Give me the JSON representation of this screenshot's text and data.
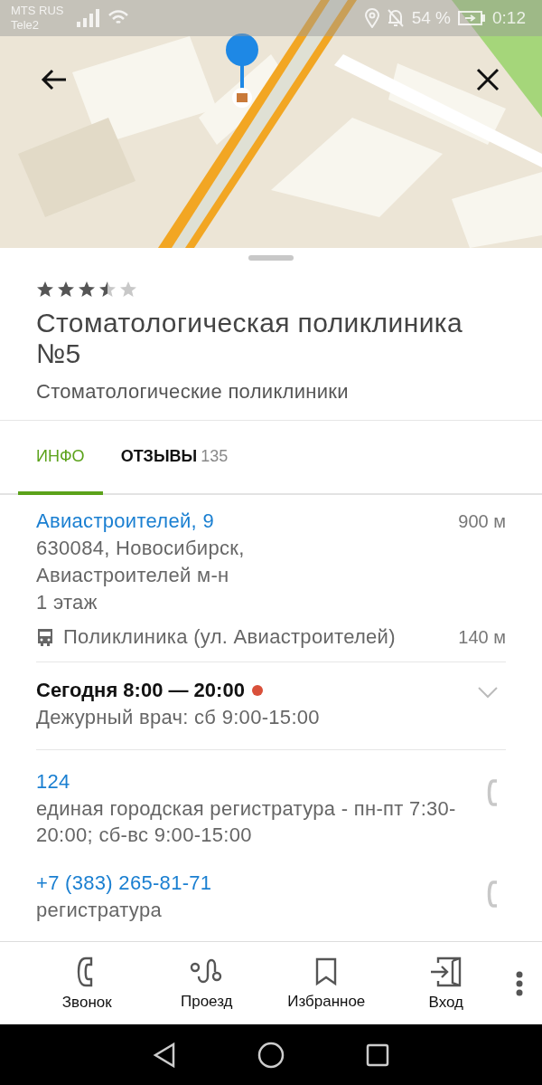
{
  "status_bar": {
    "carriers": [
      "MTS RUS",
      "Tele2"
    ],
    "battery": "54 %",
    "time": "0:12"
  },
  "place": {
    "stars": 3.5,
    "title": "Стоматологическая поликлиника №5",
    "category": "Стоматологические поликлиники"
  },
  "tabs": [
    {
      "label": "ИНФО",
      "selected": true
    },
    {
      "label": "ОТЗЫВЫ",
      "count": "135",
      "selected": false
    }
  ],
  "address": {
    "street": "Авиастроителей, 9",
    "distance": "900 м",
    "lines": [
      "630084, Новосибирск,",
      "Авиастроителей м-н",
      "1 этаж"
    ]
  },
  "transit": {
    "stop": "Поликлиника (ул. Авиастроителей)",
    "distance": "140 м"
  },
  "hours": {
    "today": "Сегодня 8:00 — 20:00",
    "open": false,
    "expanded": false,
    "note": "Дежурный врач: сб 9:00-15:00"
  },
  "phones": [
    {
      "number": "124",
      "description": "единая городская регистратура - пн-пт 7:30-20:00; сб-вс 9:00-15:00"
    },
    {
      "number": "+7 (383) 265-81-71",
      "description": "регистратура"
    }
  ],
  "actions": [
    {
      "kind": "call",
      "label": "Звонок"
    },
    {
      "kind": "route",
      "label": "Проезд"
    },
    {
      "kind": "bookmark",
      "label": "Избранное"
    },
    {
      "kind": "entrance",
      "label": "Вход"
    }
  ]
}
